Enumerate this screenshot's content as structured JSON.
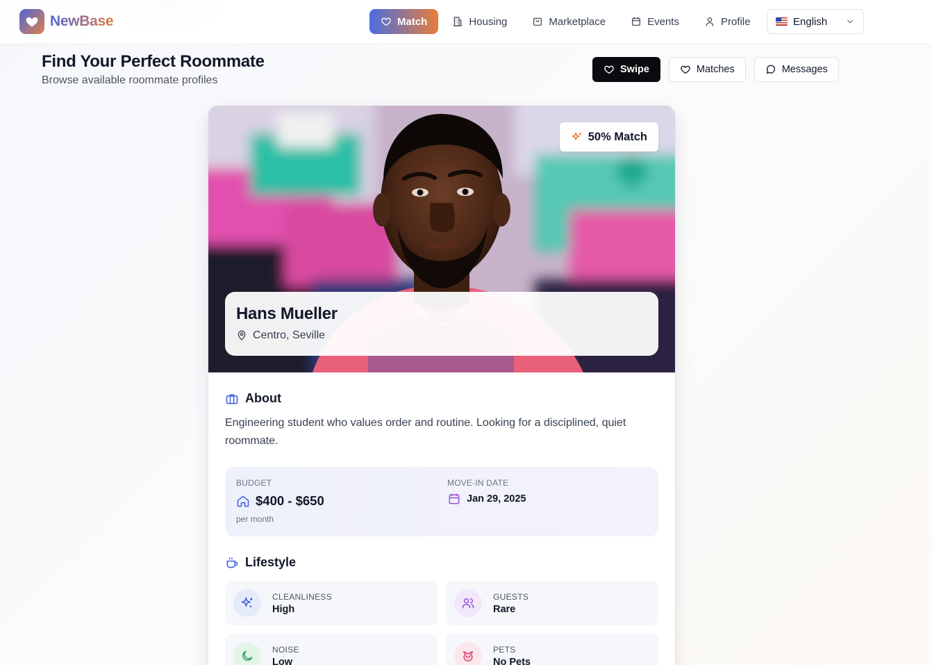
{
  "app": {
    "name": "NewBase"
  },
  "nav": {
    "items": [
      {
        "label": "Match",
        "icon": "heart-icon",
        "active": true
      },
      {
        "label": "Housing",
        "icon": "building-icon"
      },
      {
        "label": "Marketplace",
        "icon": "shopping-bag-icon"
      },
      {
        "label": "Events",
        "icon": "calendar-icon"
      },
      {
        "label": "Profile",
        "icon": "user-icon"
      }
    ],
    "language": {
      "selected": "English",
      "flag": "us-flag-icon"
    }
  },
  "header": {
    "title": "Find Your Perfect Roommate",
    "subtitle": "Browse available roommate profiles",
    "tabs": [
      {
        "label": "Swipe",
        "icon": "heart-icon",
        "active": true
      },
      {
        "label": "Matches",
        "icon": "heart-icon"
      },
      {
        "label": "Messages",
        "icon": "message-circle-icon"
      }
    ]
  },
  "profile": {
    "match_label": "50% Match",
    "name": "Hans Mueller",
    "location": "Centro, Seville",
    "about": {
      "title": "About",
      "text": "Engineering student who values order and routine. Looking for a disciplined, quiet roommate."
    },
    "budget": {
      "label": "BUDGET",
      "value": "$400 - $650",
      "note": "per month"
    },
    "move_in": {
      "label": "MOVE-IN DATE",
      "value": "Jan 29, 2025"
    },
    "lifestyle": {
      "title": "Lifestyle",
      "items": [
        {
          "label": "CLEANLINESS",
          "value": "High",
          "icon": "sparkles-icon",
          "color": "#3b5bdb",
          "bg": "#e6ebfb"
        },
        {
          "label": "GUESTS",
          "value": "Rare",
          "icon": "users-icon",
          "color": "#9b4fd6",
          "bg": "#f1e8fb"
        },
        {
          "label": "NOISE",
          "value": "Low",
          "icon": "moon-icon",
          "color": "#2f9e5b",
          "bg": "#e2f5e9"
        },
        {
          "label": "PETS",
          "value": "No Pets",
          "icon": "paw-icon",
          "color": "#d63e6b",
          "bg": "#fbe6ec"
        }
      ]
    }
  },
  "colors": {
    "accent_start": "#4b6de0",
    "accent_end": "#e67e3a",
    "primary_dark": "#0b0b0f"
  }
}
